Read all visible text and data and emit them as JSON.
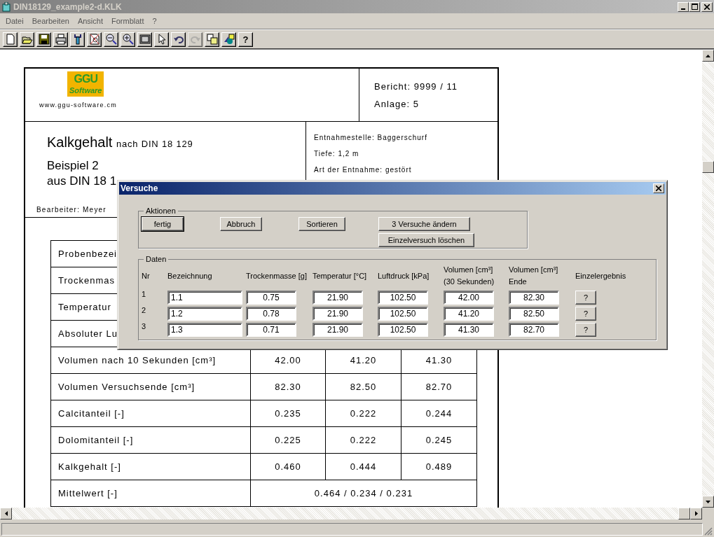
{
  "window": {
    "title": "DIN18129_example2-d.KLK"
  },
  "menu": [
    "Datei",
    "Bearbeiten",
    "Ansicht",
    "Formblatt",
    "?"
  ],
  "toolbar": [
    {
      "kind": "new",
      "disabled": false
    },
    {
      "kind": "open",
      "disabled": false
    },
    {
      "kind": "save",
      "disabled": false
    },
    {
      "kind": "print",
      "disabled": false
    },
    {
      "kind": "tool",
      "disabled": false
    },
    {
      "kind": "page",
      "disabled": false
    },
    {
      "kind": "zoomout",
      "disabled": false
    },
    {
      "kind": "zoomin",
      "disabled": false
    },
    {
      "kind": "frame",
      "disabled": false
    },
    {
      "kind": "pointer",
      "disabled": false
    },
    {
      "kind": "undo",
      "disabled": false
    },
    {
      "kind": "redo",
      "disabled": true
    },
    {
      "kind": "copy",
      "disabled": false
    },
    {
      "kind": "shapes",
      "disabled": false
    },
    {
      "kind": "help",
      "disabled": false,
      "label": "?"
    }
  ],
  "document": {
    "logo": {
      "mark": "GGU",
      "script": "Software",
      "url": "www.ggu-software.cm"
    },
    "report": "Bericht: 9999 / 11",
    "annex": "Anlage: 5",
    "title": "Kalkgehalt",
    "title_note": "nach DIN 18 129",
    "example": "Beispiel 2",
    "source": "aus DIN 18 1",
    "editor": "Bearbeiter:  Meyer",
    "sample_info": [
      "Entnahmestelle:  Baggerschurf",
      "Tiefe:  1,2 m",
      "Art der Entnahme:  gestört"
    ],
    "table": [
      {
        "kind": "split",
        "label": "Probenbezei"
      },
      {
        "kind": "split",
        "label": "Trockenmas"
      },
      {
        "kind": "split",
        "label": "Temperatur"
      },
      {
        "kind": "split",
        "label": "Absoluter Lu"
      },
      {
        "kind": "split",
        "label": "Volumen nach 10 Sekunden [cm³]",
        "values": [
          "42.00",
          "41.20",
          "41.30"
        ]
      },
      {
        "kind": "split",
        "label": "Volumen Versuchsende [cm³]",
        "values": [
          "82.30",
          "82.50",
          "82.70"
        ]
      },
      {
        "kind": "split",
        "label": "Calcitanteil [-]",
        "values": [
          "0.235",
          "0.222",
          "0.244"
        ]
      },
      {
        "kind": "split",
        "label": "Dolomitanteil [-]",
        "values": [
          "0.225",
          "0.222",
          "0.245"
        ]
      },
      {
        "kind": "split",
        "label": "Kalkgehalt [-]",
        "values": [
          "0.460",
          "0.444",
          "0.489"
        ]
      },
      {
        "kind": "merged",
        "label": "Mittelwert [-]",
        "values": [
          "0.464 / 0.234 / 0.231"
        ]
      }
    ]
  },
  "dialog": {
    "title": "Versuche",
    "actions": {
      "legend": "Aktionen",
      "buttons": [
        {
          "label": "fertig",
          "default": true
        },
        {
          "label": "Abbruch",
          "default": false
        },
        {
          "label": "Sortieren",
          "default": false
        },
        {
          "label": "3 Versuche ändern",
          "default": false
        },
        {
          "label": "Einzelversuch löschen",
          "default": false
        }
      ]
    },
    "data": {
      "legend": "Daten",
      "columns": [
        [
          "Nr"
        ],
        [
          "Bezeichnung"
        ],
        [
          "Trockenmasse [g]"
        ],
        [
          "Temperatur [°C]"
        ],
        [
          "Luftdruck [kPa]"
        ],
        [
          "Volumen [cm³]",
          "(30 Sekunden)"
        ],
        [
          "Volumen [cm³]",
          "Ende"
        ],
        [
          "Einzelergebnis"
        ]
      ],
      "rows": [
        {
          "nr": "1",
          "name": "1.1",
          "values": [
            "0.75",
            "21.90",
            "102.50",
            "42.00",
            "82.30"
          ],
          "result": "?"
        },
        {
          "nr": "2",
          "name": "1.2",
          "values": [
            "0.78",
            "21.90",
            "102.50",
            "41.20",
            "82.50"
          ],
          "result": "?"
        },
        {
          "nr": "3",
          "name": "1.3",
          "values": [
            "0.71",
            "21.90",
            "102.50",
            "41.30",
            "82.70"
          ],
          "result": "?"
        }
      ]
    }
  }
}
